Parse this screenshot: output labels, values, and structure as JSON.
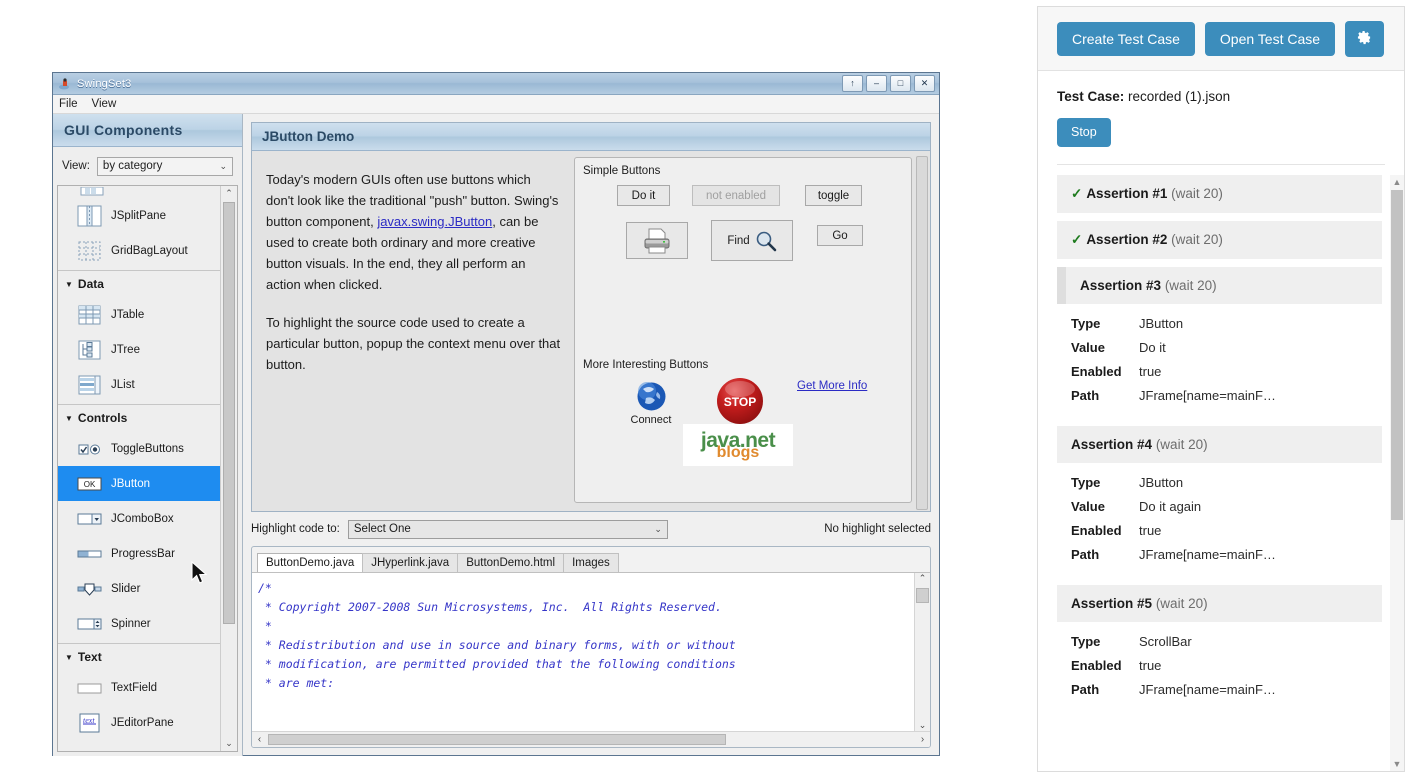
{
  "swing_window": {
    "title": "SwingSet3",
    "window_buttons": [
      "↑",
      "–",
      "□",
      "✕"
    ],
    "menubar": [
      "File",
      "View"
    ],
    "sidebar": {
      "header": "GUI Components",
      "view_label": "View:",
      "view_value": "by category",
      "items": [
        {
          "label": "JSplitPane",
          "icon": "splitpane-icon",
          "type": "item"
        },
        {
          "label": "GridBagLayout",
          "icon": "gridbaglayout-icon",
          "type": "item"
        },
        {
          "label": "Data",
          "type": "group"
        },
        {
          "label": "JTable",
          "icon": "jtable-icon",
          "type": "item"
        },
        {
          "label": "JTree",
          "icon": "jtree-icon",
          "type": "item"
        },
        {
          "label": "JList",
          "icon": "jlist-icon",
          "type": "item"
        },
        {
          "label": "Controls",
          "type": "group"
        },
        {
          "label": "ToggleButtons",
          "icon": "togglebuttons-icon",
          "type": "item"
        },
        {
          "label": "JButton",
          "icon": "jbutton-icon",
          "type": "item",
          "selected": true
        },
        {
          "label": "JComboBox",
          "icon": "jcombobox-icon",
          "type": "item"
        },
        {
          "label": "ProgressBar",
          "icon": "progressbar-icon",
          "type": "item"
        },
        {
          "label": "Slider",
          "icon": "slider-icon",
          "type": "item"
        },
        {
          "label": "Spinner",
          "icon": "spinner-icon",
          "type": "item"
        },
        {
          "label": "Text",
          "type": "group"
        },
        {
          "label": "TextField",
          "icon": "textfield-icon",
          "type": "item"
        },
        {
          "label": "JEditorPane",
          "icon": "jeditorpane-icon",
          "type": "item"
        }
      ]
    },
    "demo": {
      "header": "JButton Demo",
      "paragraph1_a": "Today's modern GUIs often use buttons which don't look like the traditional \"push\" button. Swing's button component, ",
      "paragraph1_link": "javax.swing.JButton",
      "paragraph1_b": ", can be used to create both ordinary and more creative button visuals. In the end, they all perform an action when clicked.",
      "paragraph2": "To highlight the source code used to create a particular button, popup the context menu over that button.",
      "simple_buttons_label": "Simple Buttons",
      "buttons": {
        "do_it": "Do it",
        "not_enabled": "not enabled",
        "toggle": "toggle",
        "print": "",
        "find": "Find",
        "go": "Go"
      },
      "more_buttons_label": "More Interesting Buttons",
      "connect_label": "Connect",
      "stop_label": "STOP",
      "get_more_info": "Get More Info",
      "javanet_top": "java.net",
      "javanet_bottom": "blogs"
    },
    "highlight": {
      "label": "Highlight code to:",
      "combo_value": "Select One",
      "status": "No highlight selected"
    },
    "source": {
      "tabs": [
        "ButtonDemo.java",
        "JHyperlink.java",
        "ButtonDemo.html",
        "Images"
      ],
      "active_tab": "ButtonDemo.java",
      "code": "/*\n * Copyright 2007-2008 Sun Microsystems, Inc.  All Rights Reserved.\n *\n * Redistribution and use in source and binary forms, with or without\n * modification, are permitted provided that the following conditions\n * are met:"
    }
  },
  "test_panel": {
    "toolbar": {
      "create_label": "Create Test Case",
      "open_label": "Open Test Case",
      "settings_icon": "gear-icon"
    },
    "test_case_label": "Test Case:",
    "test_case_name": "recorded (1).json",
    "stop_label": "Stop",
    "accent_color": "#3c8dbc",
    "check_color": "#1d7a1d",
    "assertions": [
      {
        "check": "✓",
        "title": "Assertion #1",
        "wait": "(wait 20)",
        "collapsed": true,
        "rows": []
      },
      {
        "check": "✓",
        "title": "Assertion #2",
        "wait": "(wait 20)",
        "collapsed": true,
        "rows": []
      },
      {
        "check": "",
        "title": "Assertion #3",
        "wait": "(wait 20)",
        "accent": true,
        "rows": [
          {
            "k": "Type",
            "v": "JButton"
          },
          {
            "k": "Value",
            "v": "Do it"
          },
          {
            "k": "Enabled",
            "v": "true"
          },
          {
            "k": "Path",
            "v": "JFrame[name=mainF…"
          }
        ]
      },
      {
        "check": "",
        "title": "Assertion #4",
        "wait": "(wait 20)",
        "rows": [
          {
            "k": "Type",
            "v": "JButton"
          },
          {
            "k": "Value",
            "v": "Do it again"
          },
          {
            "k": "Enabled",
            "v": "true"
          },
          {
            "k": "Path",
            "v": "JFrame[name=mainF…"
          }
        ]
      },
      {
        "check": "",
        "title": "Assertion #5",
        "wait": "(wait 20)",
        "rows": [
          {
            "k": "Type",
            "v": "ScrollBar"
          },
          {
            "k": "Enabled",
            "v": "true"
          },
          {
            "k": "Path",
            "v": "JFrame[name=mainF…"
          }
        ]
      }
    ]
  }
}
